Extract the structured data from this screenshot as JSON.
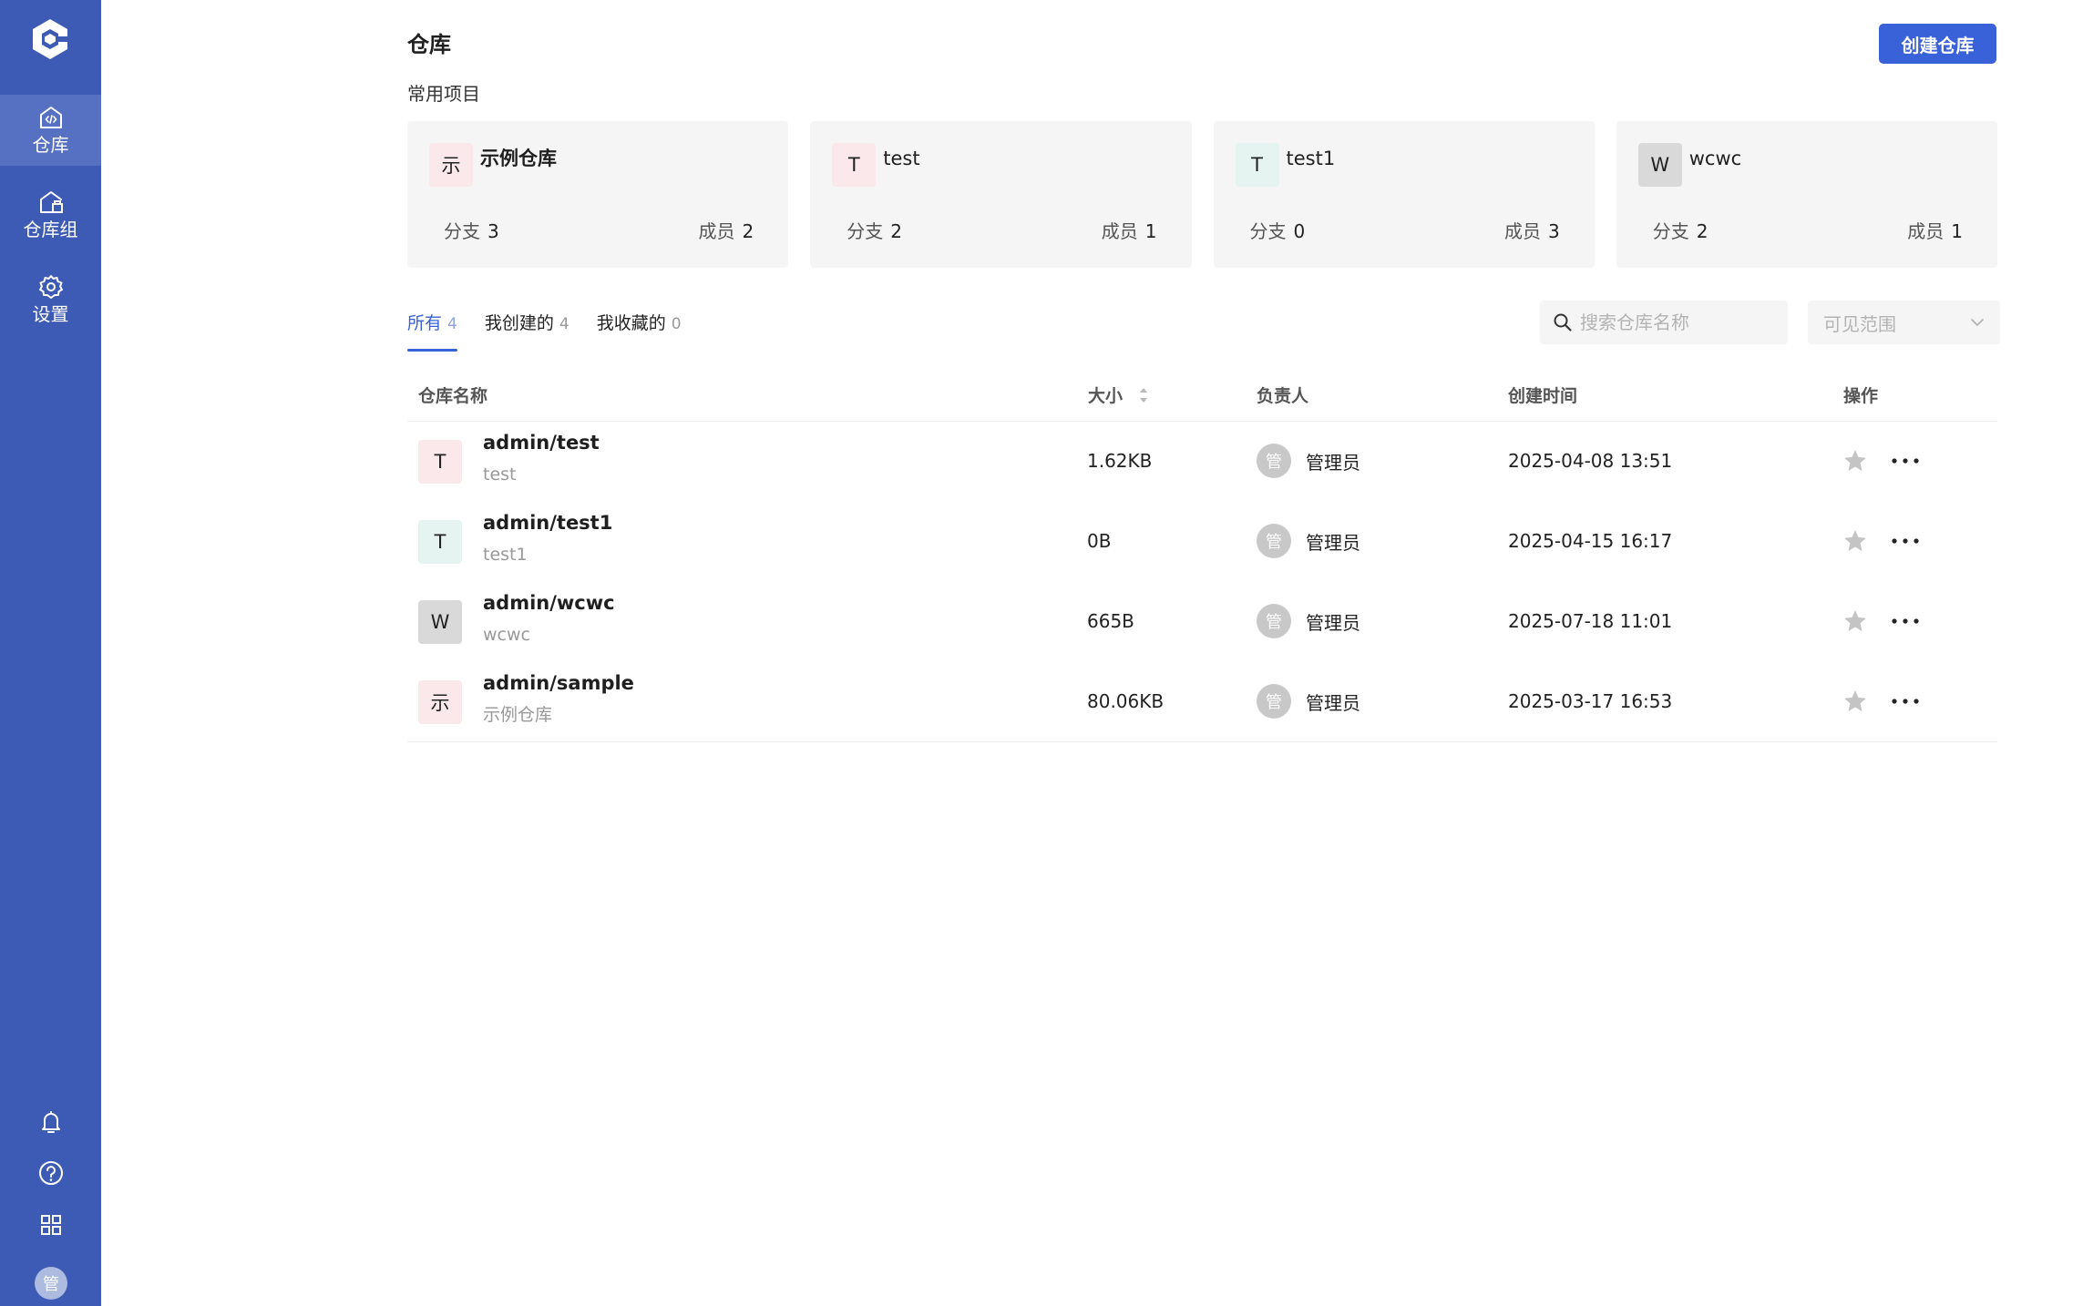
{
  "sidebar": {
    "logo": "logo-icon",
    "items": [
      {
        "label": "仓库",
        "icon": "repo-code-icon",
        "active": true
      },
      {
        "label": "仓库组",
        "icon": "repo-group-icon",
        "active": false
      },
      {
        "label": "设置",
        "icon": "gear-icon",
        "active": false
      }
    ],
    "bottom": [
      "bell-icon",
      "help-icon",
      "apps-grid-icon"
    ],
    "user_avatar": "管"
  },
  "header": {
    "title": "仓库",
    "create_button": "创建仓库"
  },
  "favorites": {
    "title": "常用项目",
    "branch_label": "分支",
    "member_label": "成员",
    "cards": [
      {
        "avatar": "示",
        "avatar_color": "#fbe8ea",
        "name": "示例仓库",
        "branches": "3",
        "members": "2"
      },
      {
        "avatar": "T",
        "avatar_color": "#fbe8ea",
        "name": "test",
        "branches": "2",
        "members": "1"
      },
      {
        "avatar": "T",
        "avatar_color": "#e5f3f1",
        "name": "test1",
        "branches": "0",
        "members": "3"
      },
      {
        "avatar": "W",
        "avatar_color": "#d9d9d9",
        "name": "wcwc",
        "branches": "2",
        "members": "1"
      }
    ]
  },
  "tabs": [
    {
      "label": "所有",
      "count": "4",
      "active": true
    },
    {
      "label": "我创建的",
      "count": "4",
      "active": false
    },
    {
      "label": "我收藏的",
      "count": "0",
      "active": false
    }
  ],
  "search": {
    "placeholder": "搜索仓库名称"
  },
  "scope_select": {
    "placeholder": "可见范围"
  },
  "table": {
    "headers": {
      "name": "仓库名称",
      "size": "大小",
      "owner": "负责人",
      "created": "创建时间",
      "actions": "操作"
    },
    "rows": [
      {
        "avatar": "T",
        "avatar_color": "#fbe8ea",
        "name": "admin/test",
        "desc": "test",
        "size": "1.62KB",
        "owner_avatar": "管",
        "owner": "管理员",
        "created": "2025-04-08 13:51"
      },
      {
        "avatar": "T",
        "avatar_color": "#e5f3f1",
        "name": "admin/test1",
        "desc": "test1",
        "size": "0B",
        "owner_avatar": "管",
        "owner": "管理员",
        "created": "2025-04-15 16:17"
      },
      {
        "avatar": "W",
        "avatar_color": "#d9d9d9",
        "name": "admin/wcwc",
        "desc": "wcwc",
        "size": "665B",
        "owner_avatar": "管",
        "owner": "管理员",
        "created": "2025-07-18 11:01"
      },
      {
        "avatar": "示",
        "avatar_color": "#fbe8ea",
        "name": "admin/sample",
        "desc": "示例仓库",
        "size": "80.06KB",
        "owner_avatar": "管",
        "owner": "管理员",
        "created": "2025-03-17 16:53"
      }
    ]
  },
  "colors": {
    "sidebar": "#3d5bb5",
    "sidebar_active": "#5670c2",
    "accent": "#3a62d8",
    "star": "#c4c4c4"
  }
}
